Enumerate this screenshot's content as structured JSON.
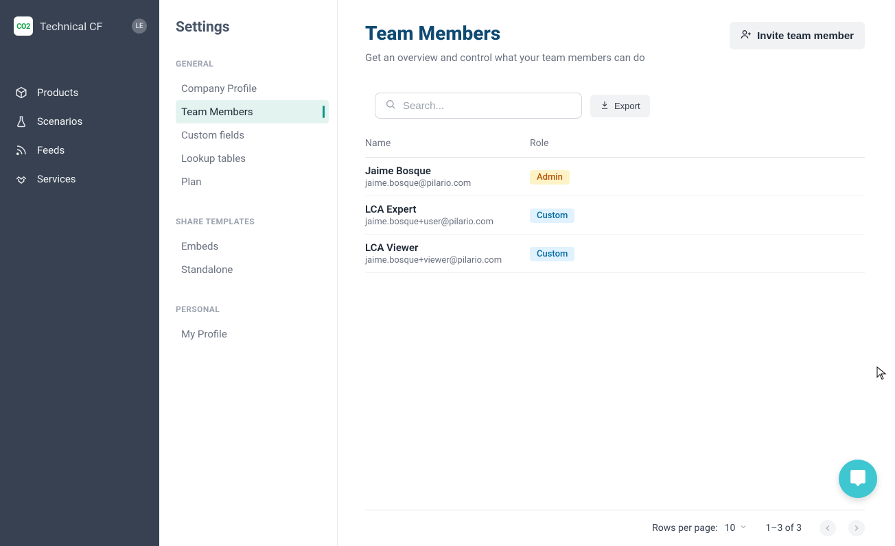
{
  "brand": {
    "name": "Technical CF",
    "logo_text": "CO2"
  },
  "avatar": "LE",
  "nav": {
    "items": [
      {
        "label": "Products"
      },
      {
        "label": "Scenarios"
      },
      {
        "label": "Feeds"
      },
      {
        "label": "Services"
      }
    ]
  },
  "settings": {
    "title": "Settings",
    "groups": {
      "general": {
        "label": "GENERAL",
        "items": [
          {
            "label": "Company Profile"
          },
          {
            "label": "Team Members"
          },
          {
            "label": "Custom fields"
          },
          {
            "label": "Lookup tables"
          },
          {
            "label": "Plan"
          }
        ]
      },
      "share": {
        "label": "SHARE TEMPLATES",
        "items": [
          {
            "label": "Embeds"
          },
          {
            "label": "Standalone"
          }
        ]
      },
      "personal": {
        "label": "PERSONAL",
        "items": [
          {
            "label": "My Profile"
          }
        ]
      }
    }
  },
  "page": {
    "title": "Team Members",
    "subtitle": "Get an overview and control what your team members can do",
    "invite_label": "Invite team member",
    "search_placeholder": "Search...",
    "export_label": "Export",
    "columns": {
      "name": "Name",
      "role": "Role"
    },
    "members": [
      {
        "name": "Jaime Bosque",
        "email": "jaime.bosque@pilario.com",
        "role": "Admin",
        "role_type": "admin"
      },
      {
        "name": "LCA Expert",
        "email": "jaime.bosque+user@pilario.com",
        "role": "Custom",
        "role_type": "custom"
      },
      {
        "name": "LCA Viewer",
        "email": "jaime.bosque+viewer@pilario.com",
        "role": "Custom",
        "role_type": "custom"
      }
    ],
    "pagination": {
      "rows_label": "Rows per page:",
      "rows_value": "10",
      "range": "1–3 of 3"
    }
  }
}
